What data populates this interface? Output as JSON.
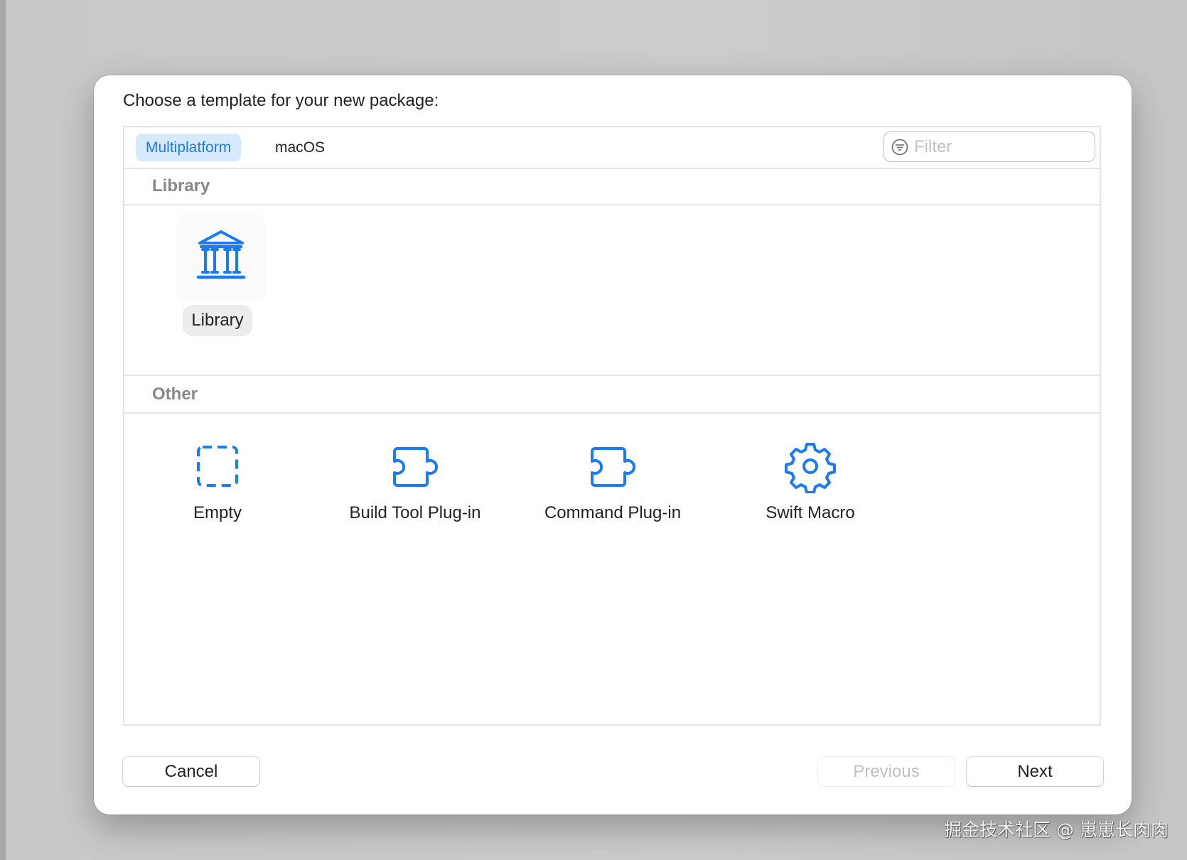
{
  "dialog": {
    "title": "Choose a template for your new package:"
  },
  "tabs": [
    {
      "label": "Multiplatform",
      "selected": true
    },
    {
      "label": "macOS",
      "selected": false
    }
  ],
  "filter": {
    "placeholder": "Filter",
    "value": "",
    "icon": "filter-circle-icon"
  },
  "sections": [
    {
      "title": "Library",
      "items": [
        {
          "label": "Library",
          "icon": "building-columns-icon",
          "selected": true
        }
      ]
    },
    {
      "title": "Other",
      "items": [
        {
          "label": "Empty",
          "icon": "dashed-square-icon"
        },
        {
          "label": "Build Tool Plug-in",
          "icon": "puzzle-piece-icon"
        },
        {
          "label": "Command Plug-in",
          "icon": "puzzle-piece-icon"
        },
        {
          "label": "Swift Macro",
          "icon": "gear-icon"
        }
      ]
    }
  ],
  "buttons": {
    "cancel": "Cancel",
    "previous": "Previous",
    "next": "Next",
    "previous_enabled": false
  },
  "watermark": "掘金技术社区 @ 崽崽长肉肉",
  "colors": {
    "accent": "#1a7cf0",
    "selected_tab_bg": "#d6e9fd",
    "header_text": "#888888"
  }
}
